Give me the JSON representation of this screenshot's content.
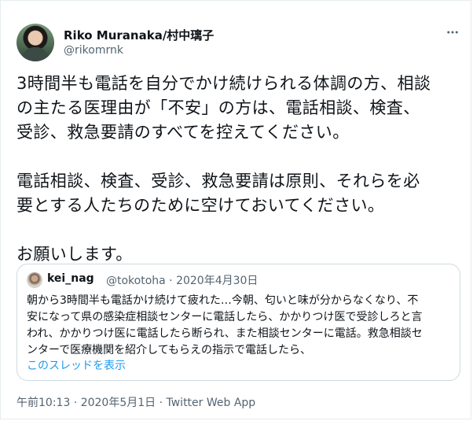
{
  "author": {
    "name": "Riko Muranaka/村中璃子",
    "handle": "@rikomrnk"
  },
  "tweet": {
    "text": "3時間半も電話を自分でかけ続けられる体調の方、相談\nの主たる医理由が「不安」の方は、電話相談、検査、\n受診、救急要請のすべてを控えてください。\n\n電話相談、検査、受診、救急要請は原則、それらを必\n要とする人たちのために空けておいてください。\n\nお願いします。"
  },
  "quote": {
    "name": "kei_nag",
    "handle_date": "@tokotoha · 2020年4月30日",
    "text": "朝から3時間半も電話かけ続けて疲れた…今朝、匂いと味が分からなくなり、不\n安になって県の感染症相談センターに電話したら、かかりつけ医で受診しろと言\nわれ、かかりつけ医に電話したら断られ、また相談センターに電話。救急相談セ\nンターで医療機関を紹介してもらえの指示で電話したら、",
    "thread_link": "このスレッドを表示"
  },
  "footer": {
    "meta": "午前10:13 · 2020年5月1日 · Twitter Web App"
  },
  "icons": {
    "more": "more-horizontal-icon"
  },
  "colors": {
    "link": "#1d9bf0",
    "secondary_text": "#536471",
    "border": "#cfd9de"
  }
}
